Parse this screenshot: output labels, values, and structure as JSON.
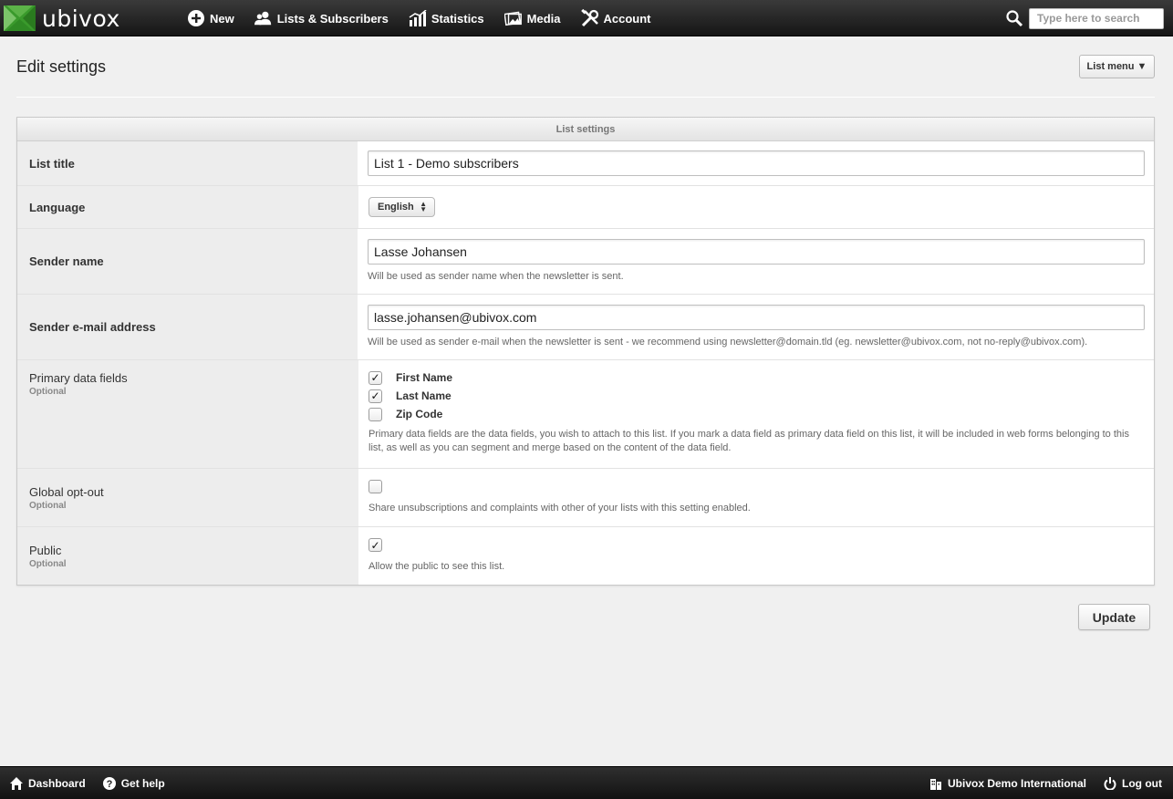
{
  "app": {
    "brand": "ubivox",
    "brand_color": "#3a9a2c"
  },
  "nav": {
    "items": [
      {
        "label": "New",
        "icon": "plus-circle-icon"
      },
      {
        "label": "Lists & Subscribers",
        "icon": "users-icon"
      },
      {
        "label": "Statistics",
        "icon": "bar-chart-icon"
      },
      {
        "label": "Media",
        "icon": "images-icon"
      },
      {
        "label": "Account",
        "icon": "tools-icon"
      }
    ],
    "search_placeholder": "Type here to search"
  },
  "header": {
    "title": "Edit settings",
    "list_menu_label": "List menu ▼"
  },
  "panel": {
    "title": "List settings",
    "list_title": {
      "label": "List title",
      "value": "List 1 - Demo subscribers"
    },
    "language": {
      "label": "Language",
      "value": "English"
    },
    "sender_name": {
      "label": "Sender name",
      "value": "Lasse Johansen",
      "help": "Will be used as sender name when the newsletter is sent."
    },
    "sender_email": {
      "label": "Sender e-mail address",
      "value": "lasse.johansen@ubivox.com",
      "help": "Will be used as sender e-mail when the newsletter is sent - we recommend using newsletter@domain.tld (eg. newsletter@ubivox.com, not no-reply@ubivox.com)."
    },
    "primary_fields": {
      "label": "Primary data fields",
      "optional": "Optional",
      "options": [
        {
          "label": "First Name",
          "checked": true
        },
        {
          "label": "Last Name",
          "checked": true
        },
        {
          "label": "Zip Code",
          "checked": false
        }
      ],
      "help": "Primary data fields are the data fields, you wish to attach to this list. If you mark a data field as primary data field on this list, it will be included in web forms belonging to this list, as well as you can segment and merge based on the content of the data field."
    },
    "global_optout": {
      "label": "Global opt-out",
      "optional": "Optional",
      "checked": false,
      "help": "Share unsubscriptions and complaints with other of your lists with this setting enabled."
    },
    "public": {
      "label": "Public",
      "optional": "Optional",
      "checked": true,
      "help": "Allow the public to see this list."
    }
  },
  "actions": {
    "update_label": "Update"
  },
  "footer": {
    "dashboard": "Dashboard",
    "help": "Get help",
    "account_name": "Ubivox Demo International",
    "logout": "Log out"
  }
}
